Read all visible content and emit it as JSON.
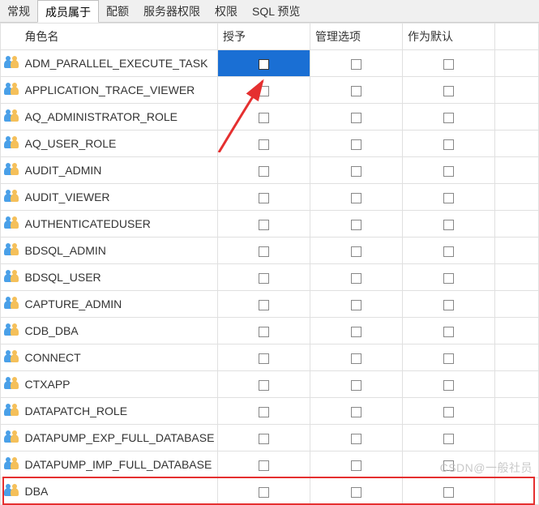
{
  "tabs": {
    "general": "常规",
    "member_of": "成员属于",
    "quota": "配额",
    "server_priv": "服务器权限",
    "privilege": "权限",
    "sql_preview": "SQL 预览"
  },
  "active_tab": "member_of",
  "columns": {
    "role_name": "角色名",
    "grant": "授予",
    "admin_option": "管理选项",
    "as_default": "作为默认"
  },
  "roles": [
    {
      "name": "ADM_PARALLEL_EXECUTE_TASK",
      "grant_selected": true
    },
    {
      "name": "APPLICATION_TRACE_VIEWER"
    },
    {
      "name": "AQ_ADMINISTRATOR_ROLE"
    },
    {
      "name": "AQ_USER_ROLE"
    },
    {
      "name": "AUDIT_ADMIN"
    },
    {
      "name": "AUDIT_VIEWER"
    },
    {
      "name": "AUTHENTICATEDUSER"
    },
    {
      "name": "BDSQL_ADMIN"
    },
    {
      "name": "BDSQL_USER"
    },
    {
      "name": "CAPTURE_ADMIN"
    },
    {
      "name": "CDB_DBA"
    },
    {
      "name": "CONNECT"
    },
    {
      "name": "CTXAPP"
    },
    {
      "name": "DATAPATCH_ROLE"
    },
    {
      "name": "DATAPUMP_EXP_FULL_DATABASE"
    },
    {
      "name": "DATAPUMP_IMP_FULL_DATABASE"
    },
    {
      "name": "DBA",
      "highlighted": true
    }
  ],
  "watermark": "CSDN@一般社员"
}
